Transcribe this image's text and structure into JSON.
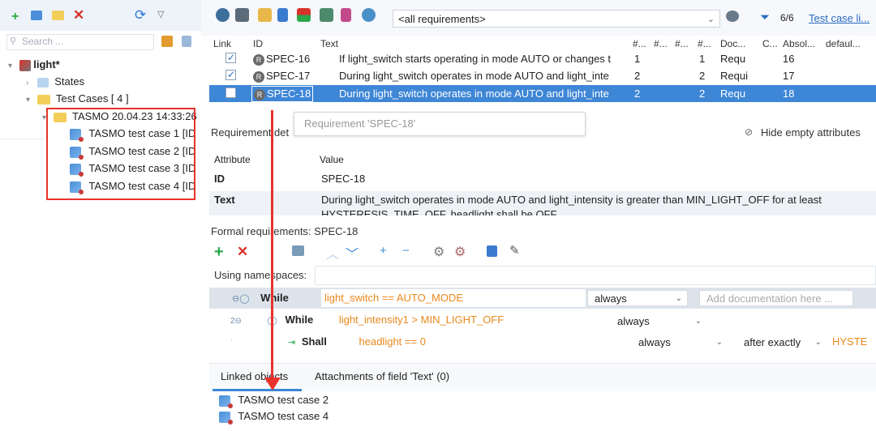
{
  "left_panel": {
    "search_placeholder": "Search ...",
    "tree": {
      "root": "light*",
      "states": "States",
      "test_cases": "Test Cases  [ 4 ]",
      "run": "TASMO 20.04.23 14:33:26",
      "cases": [
        "TASMO test case 1  [ID",
        "TASMO test case 2  [ID",
        "TASMO test case 3  [ID",
        "TASMO test case 4  [ID"
      ]
    }
  },
  "toolbar": {
    "filter_value": "<all requirements>",
    "count": "6/6",
    "test_case_link": "Test case li..."
  },
  "requirements_table": {
    "columns": [
      "Link",
      "ID",
      "Text",
      "#...",
      "#...",
      "#...",
      "#...",
      "Doc...",
      "C...",
      "Absol...",
      "defaul..."
    ],
    "rows": [
      {
        "id": "SPEC-16",
        "text": "If light_switch starts operating in mode AUTO or changes t",
        "n1": "1",
        "n2": "1",
        "doc": "Requ",
        "absol": "16"
      },
      {
        "id": "SPEC-17",
        "text": "During light_switch operates in mode AUTO and light_inte",
        "n1": "2",
        "n2": "2",
        "doc": "Requi",
        "absol": "17"
      },
      {
        "id": "SPEC-18",
        "text": "During light_switch operates in mode AUTO and light_inte",
        "n1": "2",
        "n2": "2",
        "doc": "Requ",
        "absol": "18"
      }
    ]
  },
  "details": {
    "label": "Requirement det",
    "popup": "Requirement 'SPEC-18'",
    "hide_empty": "Hide empty attributes",
    "attr_header": "Attribute",
    "value_header": "Value",
    "id_label": "ID",
    "id_value": "SPEC-18",
    "text_label": "Text",
    "text_value_1": "During light_switch operates in mode AUTO and light_intensity is greater than MIN_LIGHT_OFF for at least",
    "text_value_2": "HYSTERESIS_TIME_OFF, headlight shall be OFF."
  },
  "formal": {
    "title": "Formal requirements: SPEC-18",
    "namespaces_label": "Using namespaces:",
    "rows": [
      {
        "kw": "While",
        "expr": "light_switch == AUTO_MODE",
        "combo": "always",
        "doc_placeholder": "Add documentation here ..."
      },
      {
        "kw": "While",
        "expr": "light_intensity1 > MIN_LIGHT_OFF",
        "combo": "always"
      },
      {
        "kw": "Shall",
        "expr": "headlight == 0",
        "combo": "always",
        "combo2": "after exactly",
        "tail": "HYSTE"
      }
    ]
  },
  "bottom": {
    "tabs": [
      "Linked objects",
      "Attachments of field 'Text' (0)"
    ],
    "linked": [
      "TASMO test case 2",
      "TASMO test case 4"
    ]
  },
  "colors": {
    "accent": "#3e86d6",
    "highlight": "#e8322c",
    "expr": "#e8891c"
  }
}
